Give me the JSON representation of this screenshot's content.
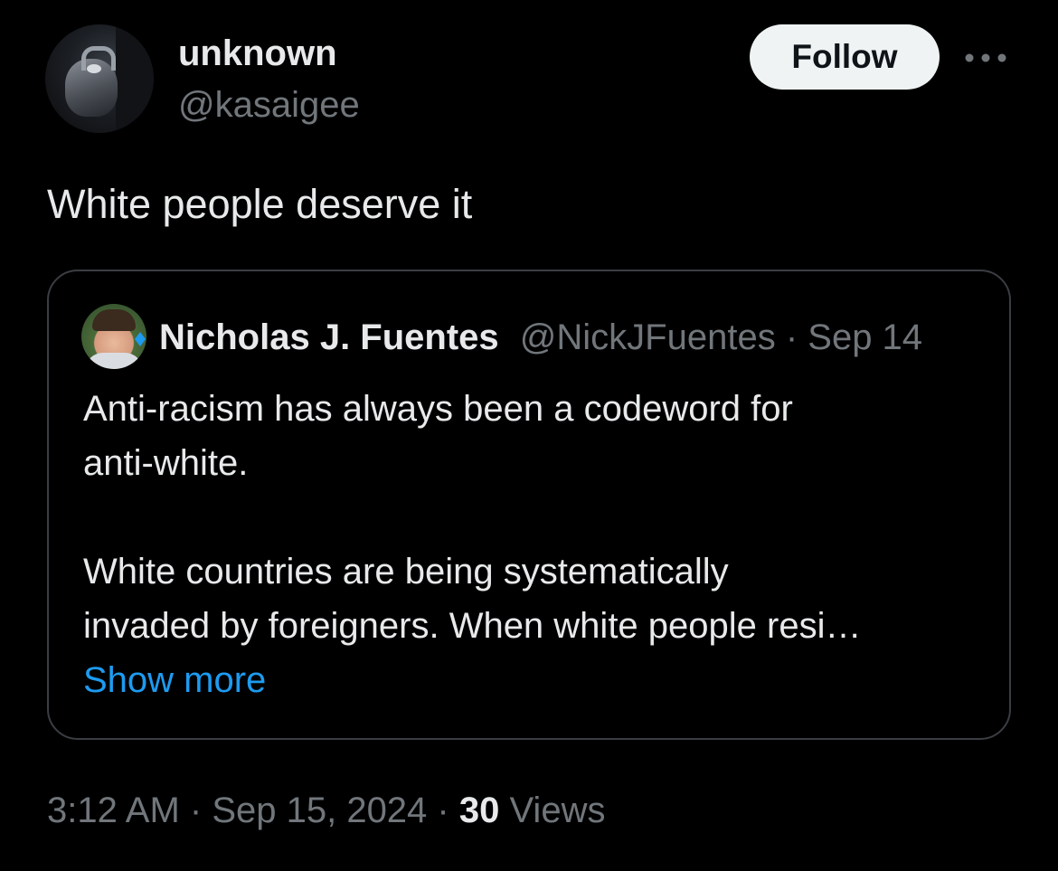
{
  "author": {
    "display_name": "unknown",
    "handle": "@kasaigee",
    "avatar_icon": "avatar-kettle-photo"
  },
  "actions": {
    "follow_label": "Follow",
    "more_icon": "more-dots-icon"
  },
  "tweet": {
    "text": "White people deserve it"
  },
  "quote": {
    "display_name": "Nicholas J. Fuentes",
    "handle": "@NickJFuentes",
    "separator": " · ",
    "date": "Sep 14",
    "paragraph_1": "Anti-racism has always been a codeword for\nanti-white.",
    "paragraph_2": "White countries are being systematically\ninvaded by foreigners. When white people resi…",
    "show_more": "Show more"
  },
  "footer": {
    "time": "3:12 AM",
    "sep1": " · ",
    "date": "Sep 15, 2024",
    "sep2": " · ",
    "views_count": "30",
    "views_label": " Views"
  },
  "colors": {
    "background": "#000000",
    "text_primary": "#e7e9ea",
    "text_secondary": "#71767b",
    "link": "#1d9bf0",
    "border": "#3a3d42",
    "follow_bg": "#eff3f4"
  }
}
